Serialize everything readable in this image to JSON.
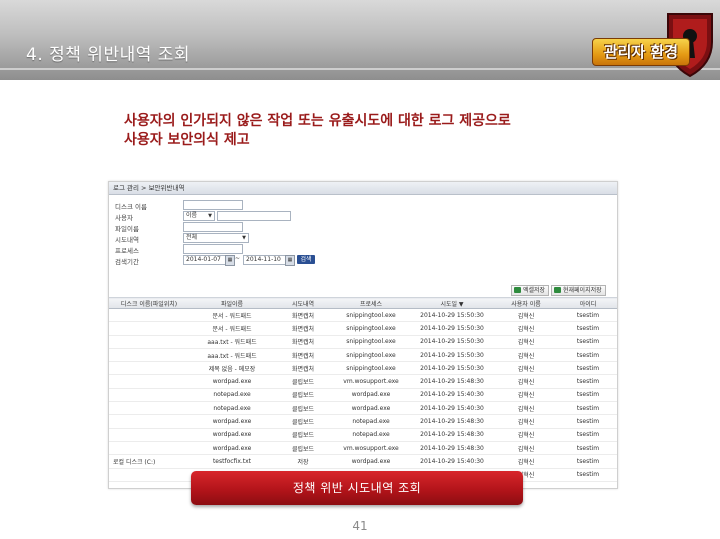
{
  "header": {
    "title": "4. 정책 위반내역 조회",
    "badge": "관리자 환경",
    "badge_icon": "shield-keyhole-icon",
    "colors": {
      "header_bg": "#bdbdbd",
      "badge": "#e49a14",
      "shield": "#b01c1c"
    }
  },
  "intro": {
    "line1": "사용자의 인가되지 않은 작업 또는 유출시도에 대한 로그 제공으로",
    "line2": "사용자 보안의식 제고",
    "color": "#9a1b1b"
  },
  "app": {
    "breadcrumb": "로그 관리 > 보안위반내역",
    "form": {
      "disk_label": "디스크 이름",
      "user_label": "사용자",
      "user_select": "이름",
      "file_label": "파일이름",
      "attempt_label": "시도내역",
      "attempt_select": "전체",
      "process_label": "프로세스",
      "period_label": "검색기간",
      "date_from": "2014-01-07",
      "date_to": "2014-11-10",
      "search_button": "검색"
    },
    "toolbar": {
      "excel_all": "엑셀저장",
      "excel_page": "현재페이지저장"
    },
    "table": {
      "columns": [
        "디스크 이름(파일위치)",
        "파일이름",
        "시도내역",
        "프로세스",
        "시도일 ▼",
        "사용자 이름",
        "아이디"
      ],
      "rows": [
        [
          "",
          "문서 - 워드패드",
          "화면캡처",
          "snippingtool.exe",
          "2014-10-29 15:50:30",
          "김혁신",
          "tsestim"
        ],
        [
          "",
          "문서 - 워드패드",
          "화면캡처",
          "snippingtool.exe",
          "2014-10-29 15:50:30",
          "김혁신",
          "tsestim"
        ],
        [
          "",
          "aaa.txt - 워드패드",
          "화면캡처",
          "snippingtool.exe",
          "2014-10-29 15:50:30",
          "김혁신",
          "tsestim"
        ],
        [
          "",
          "aaa.txt - 워드패드",
          "화면캡처",
          "snippingtool.exe",
          "2014-10-29 15:50:30",
          "김혁신",
          "tsestim"
        ],
        [
          "",
          "제목 없음 - 메모장",
          "화면캡처",
          "snippingtool.exe",
          "2014-10-29 15:50:30",
          "김혁신",
          "tsestim"
        ],
        [
          "",
          "wordpad.exe",
          "클립보드",
          "vm.wosupport.exe",
          "2014-10-29 15:48:30",
          "김혁신",
          "tsestim"
        ],
        [
          "",
          "notepad.exe",
          "클립보드",
          "wordpad.exe",
          "2014-10-29 15:40:30",
          "김혁신",
          "tsestim"
        ],
        [
          "",
          "notepad.exe",
          "클립보드",
          "wordpad.exe",
          "2014-10-29 15:40:30",
          "김혁신",
          "tsestim"
        ],
        [
          "",
          "wordpad.exe",
          "클립보드",
          "notepad.exe",
          "2014-10-29 15:48:30",
          "김혁신",
          "tsestim"
        ],
        [
          "",
          "wordpad.exe",
          "클립보드",
          "notepad.exe",
          "2014-10-29 15:48:30",
          "김혁신",
          "tsestim"
        ],
        [
          "",
          "wordpad.exe",
          "클립보드",
          "vm.wosupport.exe",
          "2014-10-29 15:48:30",
          "김혁신",
          "tsestim"
        ],
        [
          "로컬 디스크 (C:)",
          "testfocfix.txt",
          "저장",
          "wordpad.exe",
          "2014-10-29 15:40:30",
          "김혁신",
          "tsestim"
        ],
        [
          "",
          "notepad.exe",
          "클립보드",
          "wordpad.exe",
          "2014-10-29 15:40:30",
          "김혁신",
          "tsestim"
        ]
      ]
    }
  },
  "cta": {
    "label": "정책 위반 시도내역 조회",
    "color": "#b3141a"
  },
  "page": {
    "number": "41"
  }
}
